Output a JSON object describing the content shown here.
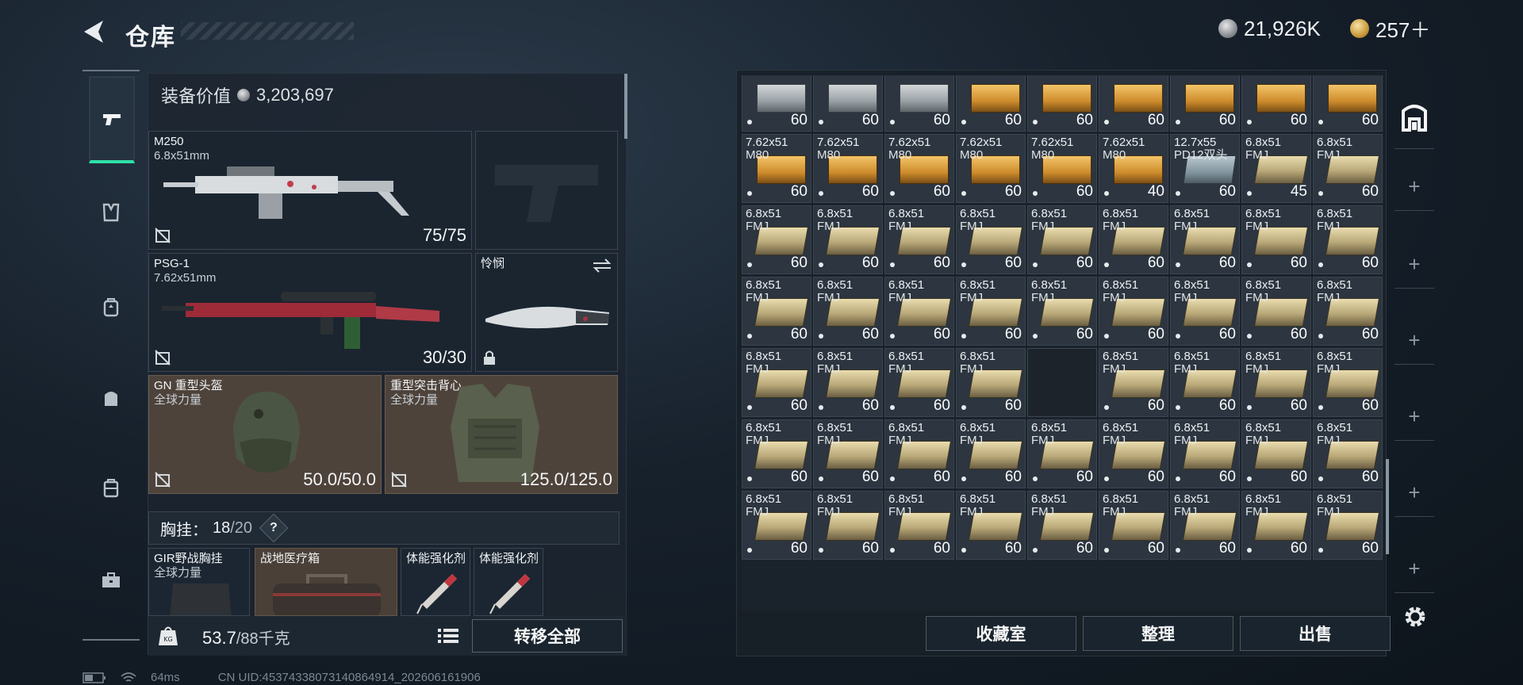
{
  "header": {
    "title": "仓库",
    "currency": [
      {
        "icon": "silver-coin-icon",
        "value": "21,926K"
      },
      {
        "icon": "gold-coin-icon",
        "value": "257＋"
      }
    ]
  },
  "nav": [
    {
      "name": "weapons",
      "icon": "pistol-icon",
      "active": true
    },
    {
      "name": "armor",
      "icon": "armor-vest-icon"
    },
    {
      "name": "backpack",
      "icon": "backpack-icon"
    },
    {
      "name": "bag",
      "icon": "bag-icon"
    },
    {
      "name": "case",
      "icon": "case-icon"
    },
    {
      "name": "toolbox",
      "icon": "toolbox-icon"
    }
  ],
  "loadout": {
    "value_label": "装备价值",
    "value": "3,203,697",
    "primary": {
      "name": "M250",
      "caliber": "6.8x51mm",
      "ammo": "75/75"
    },
    "secondary": {
      "name": "PSG-1",
      "caliber": "7.62x51mm",
      "ammo": "30/30"
    },
    "melee": {
      "name": "怜悯"
    },
    "helmet": {
      "name": "GN 重型头盔",
      "maker": "全球力量",
      "durability": "50.0/50.0"
    },
    "vest": {
      "name": "重型突击背心",
      "maker": "全球力量",
      "durability": "125.0/125.0"
    },
    "chest": {
      "label": "胸挂：",
      "used": "18",
      "max": "/20",
      "help": "?"
    },
    "chest_items": [
      {
        "name": "GIR野战胸挂",
        "maker": "全球力量"
      },
      {
        "name": "战地医疗箱"
      },
      {
        "name": "体能强化剂"
      },
      {
        "name": "体能强化剂"
      }
    ],
    "weight": {
      "current": "53.7",
      "cap": "/88千克"
    },
    "transfer_label": "转移全部"
  },
  "stash": {
    "buttons": {
      "collection": "收藏室",
      "sort": "整理",
      "sell": "出售"
    },
    "rows": [
      [
        {
          "top": "",
          "sub": "",
          "count": "60",
          "box": "gray"
        },
        {
          "top": "",
          "sub": "",
          "count": "60",
          "box": "gray"
        },
        {
          "top": "",
          "sub": "",
          "count": "60",
          "box": "gray"
        },
        {
          "top": "",
          "sub": "",
          "count": "60",
          "box": "gold"
        },
        {
          "top": "",
          "sub": "",
          "count": "60",
          "box": "gold"
        },
        {
          "top": "",
          "sub": "",
          "count": "60",
          "box": "gold"
        },
        {
          "top": "",
          "sub": "",
          "count": "60",
          "box": "gold"
        },
        {
          "top": "",
          "sub": "",
          "count": "60",
          "box": "gold"
        },
        {
          "top": "",
          "sub": "",
          "count": "60",
          "box": "gold"
        }
      ],
      [
        {
          "top": "7.62x51",
          "sub": "M80",
          "count": "60",
          "box": "gold"
        },
        {
          "top": "7.62x51",
          "sub": "M80",
          "count": "60",
          "box": "gold"
        },
        {
          "top": "7.62x51",
          "sub": "M80",
          "count": "60",
          "box": "gold"
        },
        {
          "top": "7.62x51",
          "sub": "M80",
          "count": "60",
          "box": "gold"
        },
        {
          "top": "7.62x51",
          "sub": "M80",
          "count": "60",
          "box": "gold"
        },
        {
          "top": "7.62x51",
          "sub": "M80",
          "count": "40",
          "box": "gold"
        },
        {
          "top": "12.7x55",
          "sub": "PD12双头",
          "count": "60",
          "box": "steel"
        },
        {
          "top": "6.8x51",
          "sub": "FMJ",
          "count": "45",
          "box": "khaki"
        },
        {
          "top": "6.8x51",
          "sub": "FMJ",
          "count": "60",
          "box": "khaki"
        }
      ],
      [
        {
          "top": "6.8x51",
          "sub": "FMJ",
          "count": "60",
          "box": "khaki"
        },
        {
          "top": "6.8x51",
          "sub": "FMJ",
          "count": "60",
          "box": "khaki"
        },
        {
          "top": "6.8x51",
          "sub": "FMJ",
          "count": "60",
          "box": "khaki"
        },
        {
          "top": "6.8x51",
          "sub": "FMJ",
          "count": "60",
          "box": "khaki"
        },
        {
          "top": "6.8x51",
          "sub": "FMJ",
          "count": "60",
          "box": "khaki"
        },
        {
          "top": "6.8x51",
          "sub": "FMJ",
          "count": "60",
          "box": "khaki"
        },
        {
          "top": "6.8x51",
          "sub": "FMJ",
          "count": "60",
          "box": "khaki"
        },
        {
          "top": "6.8x51",
          "sub": "FMJ",
          "count": "60",
          "box": "khaki"
        },
        {
          "top": "6.8x51",
          "sub": "FMJ",
          "count": "60",
          "box": "khaki"
        }
      ],
      [
        {
          "top": "6.8x51",
          "sub": "FMJ",
          "count": "60",
          "box": "khaki"
        },
        {
          "top": "6.8x51",
          "sub": "FMJ",
          "count": "60",
          "box": "khaki"
        },
        {
          "top": "6.8x51",
          "sub": "FMJ",
          "count": "60",
          "box": "khaki"
        },
        {
          "top": "6.8x51",
          "sub": "FMJ",
          "count": "60",
          "box": "khaki"
        },
        {
          "top": "6.8x51",
          "sub": "FMJ",
          "count": "60",
          "box": "khaki"
        },
        {
          "top": "6.8x51",
          "sub": "FMJ",
          "count": "60",
          "box": "khaki"
        },
        {
          "top": "6.8x51",
          "sub": "FMJ",
          "count": "60",
          "box": "khaki"
        },
        {
          "top": "6.8x51",
          "sub": "FMJ",
          "count": "60",
          "box": "khaki"
        },
        {
          "top": "6.8x51",
          "sub": "FMJ",
          "count": "60",
          "box": "khaki"
        }
      ],
      [
        {
          "top": "6.8x51",
          "sub": "FMJ",
          "count": "60",
          "box": "khaki"
        },
        {
          "top": "6.8x51",
          "sub": "FMJ",
          "count": "60",
          "box": "khaki"
        },
        {
          "top": "6.8x51",
          "sub": "FMJ",
          "count": "60",
          "box": "khaki"
        },
        {
          "top": "6.8x51",
          "sub": "FMJ",
          "count": "60",
          "box": "khaki"
        },
        {
          "empty": true
        },
        {
          "top": "6.8x51",
          "sub": "FMJ",
          "count": "60",
          "box": "khaki"
        },
        {
          "top": "6.8x51",
          "sub": "FMJ",
          "count": "60",
          "box": "khaki"
        },
        {
          "top": "6.8x51",
          "sub": "FMJ",
          "count": "60",
          "box": "khaki"
        },
        {
          "top": "6.8x51",
          "sub": "FMJ",
          "count": "60",
          "box": "khaki"
        }
      ],
      [
        {
          "top": "6.8x51",
          "sub": "FMJ",
          "count": "60",
          "box": "khaki"
        },
        {
          "top": "6.8x51",
          "sub": "FMJ",
          "count": "60",
          "box": "khaki"
        },
        {
          "top": "6.8x51",
          "sub": "FMJ",
          "count": "60",
          "box": "khaki"
        },
        {
          "top": "6.8x51",
          "sub": "FMJ",
          "count": "60",
          "box": "khaki"
        },
        {
          "top": "6.8x51",
          "sub": "FMJ",
          "count": "60",
          "box": "khaki"
        },
        {
          "top": "6.8x51",
          "sub": "FMJ",
          "count": "60",
          "box": "khaki"
        },
        {
          "top": "6.8x51",
          "sub": "FMJ",
          "count": "60",
          "box": "khaki"
        },
        {
          "top": "6.8x51",
          "sub": "FMJ",
          "count": "60",
          "box": "khaki"
        },
        {
          "top": "6.8x51",
          "sub": "FMJ",
          "count": "60",
          "box": "khaki"
        }
      ],
      [
        {
          "top": "6.8x51",
          "sub": "FMJ",
          "count": "60",
          "box": "khaki"
        },
        {
          "top": "6.8x51",
          "sub": "FMJ",
          "count": "60",
          "box": "khaki"
        },
        {
          "top": "6.8x51",
          "sub": "FMJ",
          "count": "60",
          "box": "khaki"
        },
        {
          "top": "6.8x51",
          "sub": "FMJ",
          "count": "60",
          "box": "khaki"
        },
        {
          "top": "6.8x51",
          "sub": "FMJ",
          "count": "60",
          "box": "khaki"
        },
        {
          "top": "6.8x51",
          "sub": "FMJ",
          "count": "60",
          "box": "khaki"
        },
        {
          "top": "6.8x51",
          "sub": "FMJ",
          "count": "60",
          "box": "khaki"
        },
        {
          "top": "6.8x51",
          "sub": "FMJ",
          "count": "60",
          "box": "khaki"
        },
        {
          "top": "6.8x51",
          "sub": "FMJ",
          "count": "60",
          "box": "khaki"
        }
      ]
    ]
  },
  "right_rail": [
    "+",
    "+",
    "+",
    "+",
    "+",
    "+"
  ],
  "status": {
    "ping": "64ms",
    "uid": "CN UID:4537433807314086491​4_202606161906"
  },
  "colors": {
    "accent": "#2ee0a9",
    "panel": "#1c252f",
    "warm_slot": "#4e433b"
  }
}
